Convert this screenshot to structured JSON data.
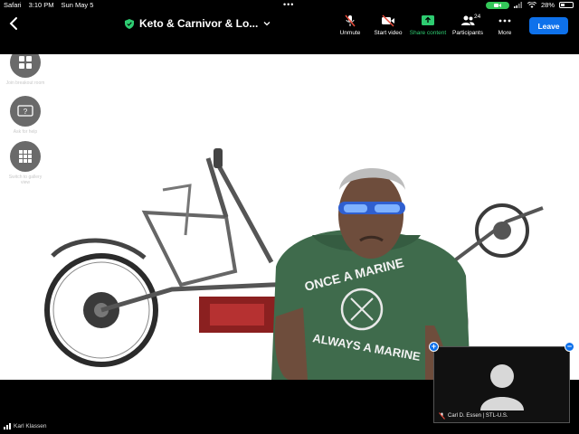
{
  "status_bar": {
    "app": "Safari",
    "time": "3:10 PM",
    "date": "Sun May 5",
    "dots": "•••",
    "battery": "28%"
  },
  "toolbar": {
    "meeting_title": "Keto & Carnivor & Lo...",
    "unmute_label": "Unmute",
    "video_label": "Start video",
    "share_label": "Share content",
    "participants_label": "Participants",
    "participants_count": "24",
    "more_label": "More",
    "leave_label": "Leave",
    "colors": {
      "share": "#2ecc71",
      "leave": "#0e71eb",
      "muted": "#e74c3c"
    }
  },
  "side_buttons": [
    {
      "label": "Join breakout room",
      "icon": "grid-icon"
    },
    {
      "label": "Ask for help",
      "icon": "help-icon"
    },
    {
      "label": "Switch to gallery view",
      "icon": "gallery-icon"
    }
  ],
  "speaker": {
    "shirt_line_1": "ONCE A MARINE",
    "shirt_line_2": "ALWAYS A MARINE"
  },
  "self_view": {
    "name": "Carl D. Essen | STL-U.S."
  },
  "bottom": {
    "name": "Karl Klassen"
  }
}
